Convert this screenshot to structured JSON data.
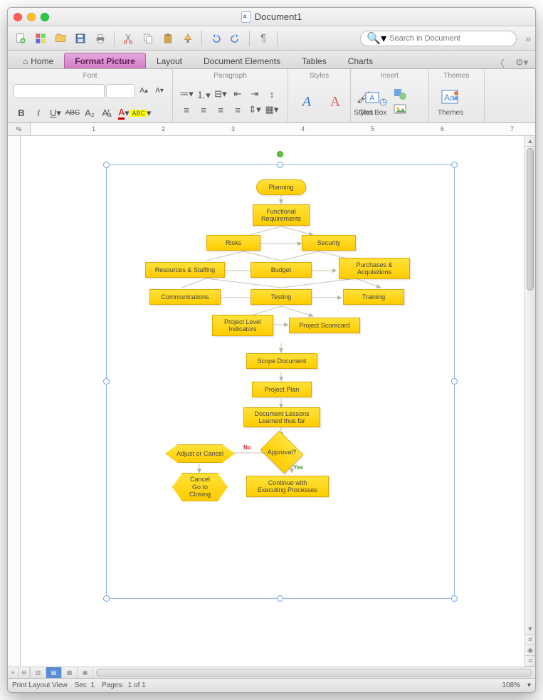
{
  "window": {
    "title": "Document1"
  },
  "search": {
    "placeholder": "Search in Document"
  },
  "tabs": {
    "home": "Home",
    "format_picture": "Format Picture",
    "layout": "Layout",
    "document_elements": "Document Elements",
    "tables": "Tables",
    "charts": "Charts"
  },
  "ribbon": {
    "font_group": "Font",
    "paragraph_group": "Paragraph",
    "styles_group": "Styles",
    "styles_btn": "Styles",
    "insert_group": "Insert",
    "textbox_btn": "Text Box",
    "themes_group": "Themes",
    "themes_btn": "Themes"
  },
  "status": {
    "view_label": "Print Layout View",
    "sec_label": "Sec",
    "sec_value": "1",
    "pages_label": "Pages:",
    "pages_value": "1 of 1",
    "zoom": "108%"
  },
  "flowchart": {
    "planning": "Planning",
    "functional_req": "Functional\nRequirements",
    "risks": "Risks",
    "security": "Security",
    "resources": "Resources & Staffing",
    "budget": "Budget",
    "purchases": "Purchases &\nAcquisitions",
    "communications": "Communications",
    "testing": "Testing",
    "training": "Training",
    "pli": "Project Level\nIndicators",
    "scorecard": "Project Scorecard",
    "scope": "Scope Document",
    "plan": "Project Plan",
    "lessons": "Document Lessons\nLearned thus far",
    "approval": "Approval?",
    "adjust": "Adjust or Cancel",
    "cancel": "Cancel\nGo to\nClosing",
    "continue": "Continue with\nExecuting Processes",
    "no": "No",
    "yes": "Yes"
  },
  "ruler": [
    "1",
    "2",
    "3",
    "4",
    "5",
    "6",
    "7"
  ]
}
